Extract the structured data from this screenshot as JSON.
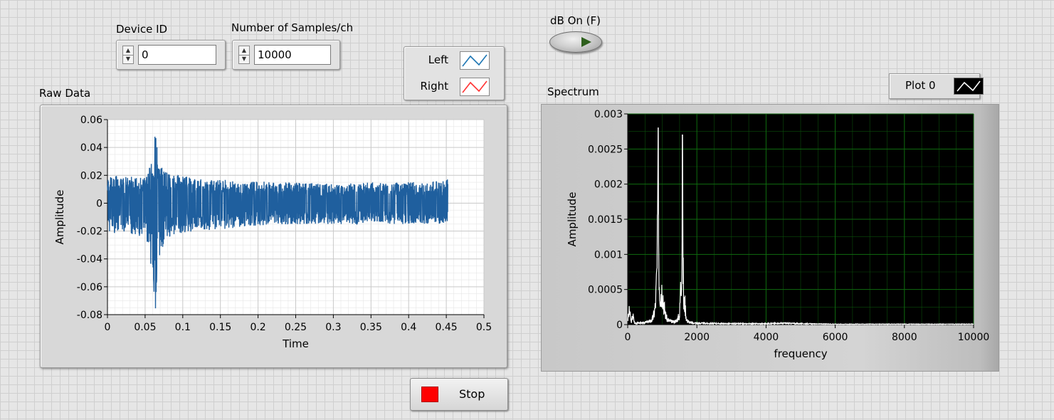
{
  "controls": {
    "device_id": {
      "label": "Device ID",
      "value": "0"
    },
    "samples": {
      "label": "Number of Samples/ch",
      "value": "10000"
    },
    "db_toggle": {
      "label": "dB On (F)",
      "state": false
    },
    "stop": {
      "label": "Stop"
    }
  },
  "raw_legend": {
    "items": [
      {
        "name": "Left",
        "color": "#1f77b4"
      },
      {
        "name": "Right",
        "color": "#ff3333"
      }
    ]
  },
  "spectrum_legend": {
    "name": "Plot 0",
    "color": "#000000"
  },
  "colors": {
    "raw_trace": "#1f5f9e",
    "spectrum_trace": "#ffffff",
    "spectrum_bg": "#000000",
    "spectrum_grid": "#0f6a0f",
    "stop_red": "#ff0000",
    "db_led": "#2e5f1d"
  },
  "chart_data": [
    {
      "type": "line",
      "title": "Raw Data",
      "xlabel": "Time",
      "ylabel": "Amplitude",
      "xlim": [
        0,
        0.5
      ],
      "ylim": [
        -0.08,
        0.06
      ],
      "xticks": [
        "0",
        "0.05",
        "0.1",
        "0.15",
        "0.2",
        "0.25",
        "0.3",
        "0.35",
        "0.4",
        "0.45",
        "0.5"
      ],
      "yticks": [
        "0.06",
        "0.04",
        "0.02",
        "0",
        "-0.02",
        "-0.04",
        "-0.06",
        "-0.08"
      ],
      "grid": true,
      "series": [
        {
          "x": [
            0,
            0.01,
            0.02,
            0.03,
            0.04,
            0.05,
            0.055,
            0.06,
            0.062,
            0.064,
            0.066,
            0.068,
            0.07,
            0.075,
            0.08,
            0.09,
            0.1,
            0.12,
            0.15,
            0.18,
            0.2,
            0.25,
            0.3,
            0.35,
            0.4,
            0.45,
            0.452
          ],
          "y_upper": [
            0.018,
            0.02,
            0.018,
            0.02,
            0.018,
            0.02,
            0.025,
            0.03,
            0.04,
            0.06,
            0.045,
            0.035,
            0.03,
            0.025,
            0.022,
            0.02,
            0.02,
            0.018,
            0.017,
            0.016,
            0.016,
            0.015,
            0.014,
            0.015,
            0.015,
            0.016,
            0.02
          ],
          "y_lower": [
            -0.02,
            -0.022,
            -0.02,
            -0.022,
            -0.024,
            -0.022,
            -0.04,
            -0.055,
            -0.07,
            -0.077,
            -0.06,
            -0.045,
            -0.035,
            -0.03,
            -0.025,
            -0.023,
            -0.022,
            -0.02,
            -0.019,
            -0.017,
            -0.016,
            -0.015,
            -0.015,
            -0.015,
            -0.015,
            -0.015,
            -0.012
          ]
        }
      ]
    },
    {
      "type": "line",
      "title": "Spectrum",
      "xlabel": "frequency",
      "ylabel": "Amplitude",
      "xlim": [
        0,
        10000
      ],
      "ylim": [
        0,
        0.003
      ],
      "xticks": [
        "0",
        "2000",
        "4000",
        "6000",
        "8000",
        "10000"
      ],
      "yticks": [
        "0.003",
        "0.0025",
        "0.002",
        "0.0015",
        "0.001",
        "0.0005",
        "0"
      ],
      "grid": true,
      "series": [
        {
          "name": "Plot 0",
          "x": [
            0,
            50,
            100,
            150,
            200,
            300,
            400,
            500,
            600,
            700,
            750,
            800,
            850,
            880,
            900,
            920,
            950,
            1000,
            1050,
            1100,
            1150,
            1200,
            1300,
            1400,
            1500,
            1550,
            1580,
            1600,
            1620,
            1650,
            1700,
            1800,
            2000,
            3000,
            4000,
            4500,
            5000,
            6000,
            7000,
            8000,
            9000,
            10000
          ],
          "y": [
            0.0001,
            0.0003,
            5e-05,
            0.0002,
            3e-05,
            4e-05,
            3e-05,
            5e-05,
            6e-05,
            0.0001,
            0.0002,
            0.0004,
            0.0012,
            0.0028,
            0.0017,
            0.0008,
            0.0007,
            0.0008,
            0.0004,
            0.0002,
            0.0001,
            8e-05,
            6e-05,
            8e-05,
            0.0002,
            0.0012,
            0.0027,
            0.0014,
            0.0004,
            0.0005,
            0.0001,
            4e-05,
            3e-05,
            2e-05,
            2e-05,
            3e-05,
            2e-05,
            1e-05,
            1e-05,
            1e-05,
            1e-05,
            1e-05
          ]
        }
      ]
    }
  ]
}
